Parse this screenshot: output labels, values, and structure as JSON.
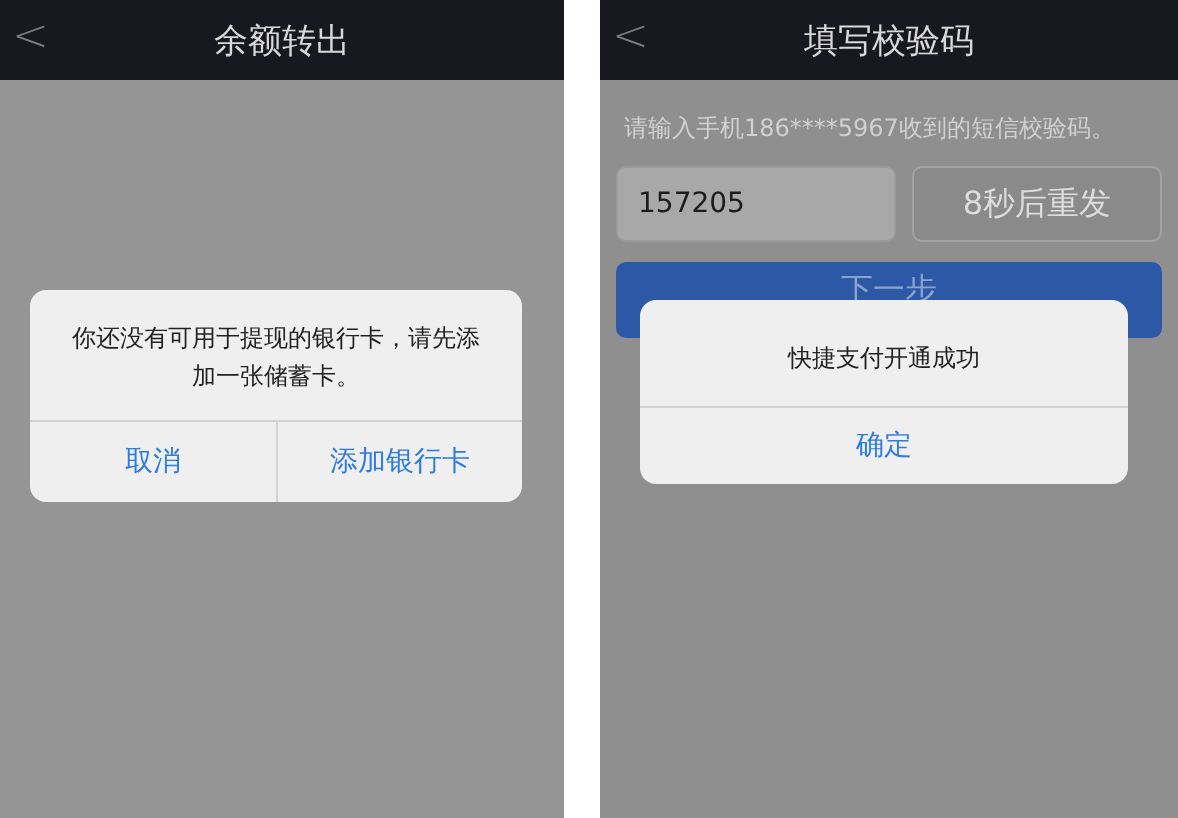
{
  "screens": [
    {
      "title": "余额转出",
      "back": "<",
      "dialog": {
        "message": "你还没有可用于提现的银行卡，请先添加一张储蓄卡。",
        "buttons": [
          "取消",
          "添加银行卡"
        ]
      }
    },
    {
      "title": "填写校验码",
      "back": "<",
      "hint": "请输入手机186****5967收到的短信校验码。",
      "code_value": "157205",
      "resend": "8秒后重发",
      "next": "下一步",
      "dialog": {
        "message": "快捷支付开通成功",
        "buttons": [
          "确定"
        ]
      }
    }
  ]
}
